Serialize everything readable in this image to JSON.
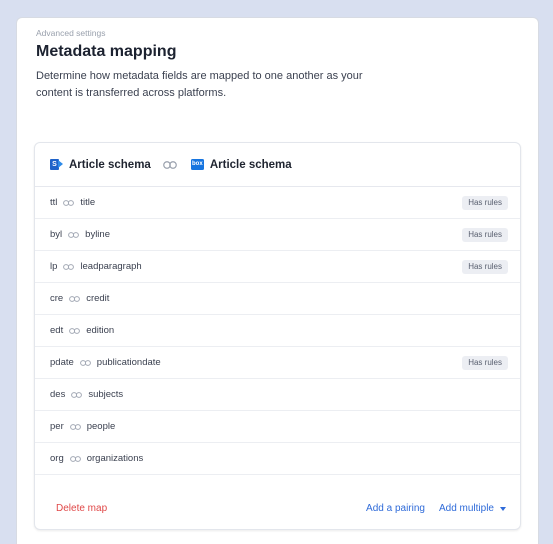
{
  "header": {
    "eyebrow": "Advanced settings",
    "title": "Metadata mapping",
    "description": "Determine how metadata fields are mapped to one another as your content is transferred across platforms."
  },
  "schemas": {
    "source": {
      "label": "Article schema",
      "icon": "sharepoint-logo-icon",
      "logo_text": "S"
    },
    "target": {
      "label": "Article schema",
      "icon": "box-logo-icon",
      "logo_text": "box"
    }
  },
  "mappings": [
    {
      "source": "ttl",
      "target": "title",
      "badge": "Has rules"
    },
    {
      "source": "byl",
      "target": "byline",
      "badge": "Has rules"
    },
    {
      "source": "lp",
      "target": "leadparagraph",
      "badge": "Has rules"
    },
    {
      "source": "cre",
      "target": "credit",
      "badge": ""
    },
    {
      "source": "edt",
      "target": "edition",
      "badge": ""
    },
    {
      "source": "pdate",
      "target": "publicationdate",
      "badge": "Has rules"
    },
    {
      "source": "des",
      "target": "subjects",
      "badge": ""
    },
    {
      "source": "per",
      "target": "people",
      "badge": ""
    },
    {
      "source": "org",
      "target": "organizations",
      "badge": ""
    }
  ],
  "footer": {
    "delete_label": "Delete map",
    "add_pairing_label": "Add a pairing",
    "add_multiple_label": "Add multiple"
  },
  "colors": {
    "page_bg": "#d8dff0",
    "danger": "#e04848",
    "accent": "#2f6bd9",
    "badge_bg": "#eceef3"
  }
}
